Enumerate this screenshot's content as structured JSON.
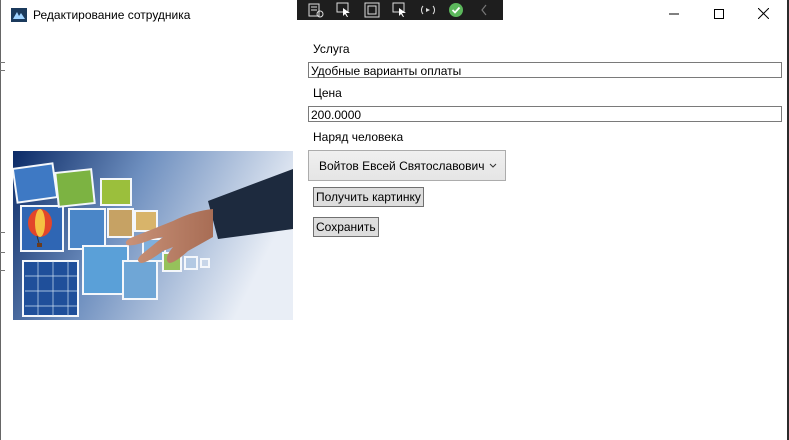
{
  "window": {
    "title": "Редактирование сотрудника",
    "controls": [
      "minimize-icon",
      "maximize-icon",
      "close-icon"
    ]
  },
  "devtools": {
    "tools": [
      "live-visual-tree-icon",
      "select-element-icon",
      "display-adorners-icon",
      "track-focus-icon",
      "hot-reload-icon",
      "binding-check-icon",
      "collapse-chevron-icon"
    ]
  },
  "form": {
    "service_label": "Услуга",
    "service_value": "Удобные варианты оплаты",
    "price_label": "Цена",
    "price_value": "200.0000",
    "assignee_label": "Наряд человека",
    "assignee_value": "Войтов Евсей Святославович",
    "get_picture_button": "Получить картинку",
    "save_button": "Сохранить"
  },
  "image": {
    "subject": "hand-reaching-floating-photos"
  },
  "colors": {
    "devbar_bg": "#1e1e1e",
    "check_green": "#5cb85c",
    "button_bg": "#dddddd"
  }
}
